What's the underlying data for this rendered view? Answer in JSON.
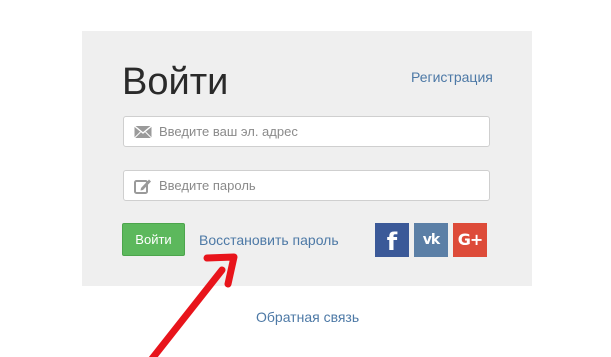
{
  "login": {
    "title": "Войти",
    "register_link": "Регистрация",
    "email": {
      "placeholder": "Введите ваш эл. адрес",
      "value": "",
      "icon": "envelope-icon"
    },
    "password": {
      "placeholder": "Введите пароль",
      "value": "",
      "icon": "pencil-icon"
    },
    "submit_label": "Войти",
    "restore_password_link": "Восстановить пароль",
    "social": [
      {
        "name": "facebook",
        "glyph": "f",
        "color": "#3b5998",
        "icon": "facebook-icon"
      },
      {
        "name": "vk",
        "glyph": "vk",
        "color": "#5b7fa6",
        "icon": "vk-icon"
      },
      {
        "name": "google-plus",
        "glyph": "G+",
        "color": "#dd4b39",
        "icon": "google-plus-icon"
      }
    ]
  },
  "footer": {
    "feedback_link": "Обратная связь"
  },
  "colors": {
    "panel_bg": "#efefef",
    "link": "#4d79a6",
    "submit_green": "#5cb85c",
    "annotation_red": "#e8141b"
  }
}
